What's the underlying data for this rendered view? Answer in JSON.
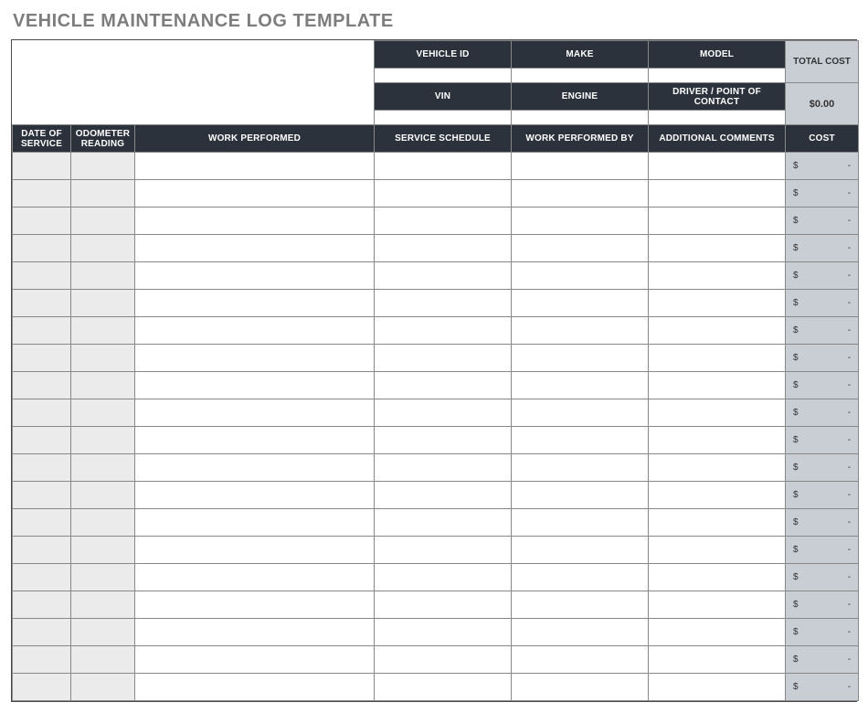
{
  "title": "VEHICLE MAINTENANCE LOG TEMPLATE",
  "vehicle_info": {
    "row1": {
      "c1_label": "VEHICLE ID",
      "c2_label": "MAKE",
      "c3_label": "MODEL",
      "c1_value": "",
      "c2_value": "",
      "c3_value": ""
    },
    "row2": {
      "c1_label": "VIN",
      "c2_label": "ENGINE",
      "c3_label": "DRIVER / POINT OF CONTACT",
      "c1_value": "",
      "c2_value": "",
      "c3_value": ""
    },
    "total_cost_label": "TOTAL COST",
    "total_cost_value": "$0.00"
  },
  "columns": {
    "date_of_service": "DATE OF SERVICE",
    "odometer": "ODOMETER READING",
    "work_performed": "WORK PERFORMED",
    "service_schedule": "SERVICE SCHEDULE",
    "work_performed_by": "WORK PERFORMED BY",
    "additional_comments": "ADDITIONAL COMMENTS",
    "cost": "COST"
  },
  "cost_cell": {
    "currency": "$",
    "dash": "-"
  },
  "row_count": 20
}
